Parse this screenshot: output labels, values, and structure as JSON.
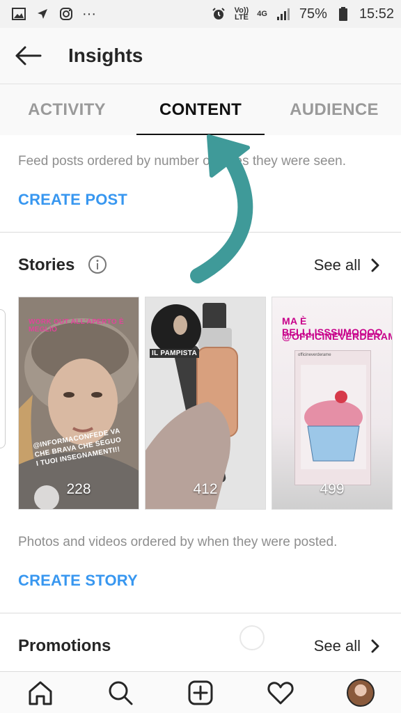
{
  "status_bar": {
    "icons_left": [
      "image-icon",
      "location-icon",
      "instagram-icon",
      "more-icon"
    ],
    "more_dots": "···",
    "network_top": "Vo))",
    "network_bottom": "LTE",
    "lte_label": "4G",
    "battery": "75%",
    "time": "15:52"
  },
  "header": {
    "title": "Insights"
  },
  "tabs": [
    {
      "label": "ACTIVITY",
      "active": false
    },
    {
      "label": "CONTENT",
      "active": true
    },
    {
      "label": "AUDIENCE",
      "active": false
    }
  ],
  "feed": {
    "description": "Feed posts ordered by number of times they were seen.",
    "cta": "CREATE POST"
  },
  "stories": {
    "title": "Stories",
    "see_all": "See all",
    "items": [
      {
        "views": "228",
        "caption_top": "WORK OUT ALL'APERTO È MEGLIO",
        "caption_mid": "@INFORMACONFEDE VA CHE BRAVA CHE SEGUO I TUOI INSEGNAMENTI!!"
      },
      {
        "views": "412",
        "caption_top": "IL PAMPISTA"
      },
      {
        "views": "499",
        "caption_top": "MA È BELLLISSSIIMOOOO",
        "caption_sub": "@OFFICINEVERDERAME",
        "caption_post": "officineverderame"
      }
    ],
    "description": "Photos and videos ordered by when they were posted.",
    "cta": "CREATE STORY"
  },
  "promotions": {
    "title": "Promotions",
    "see_all": "See all"
  },
  "colors": {
    "accent_blue": "#3897f0",
    "arrow_teal": "#3f9a99",
    "text_dark": "#262626",
    "text_muted": "#8e8e8e"
  },
  "bottom_nav": [
    "home-icon",
    "search-icon",
    "add-post-icon",
    "heart-icon",
    "profile-avatar"
  ]
}
